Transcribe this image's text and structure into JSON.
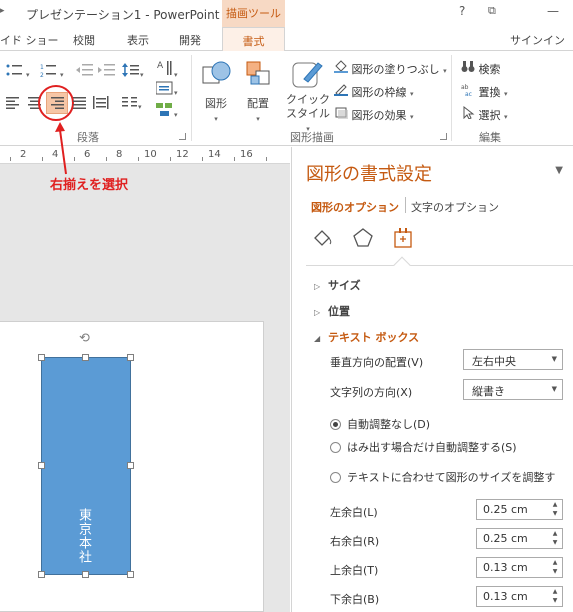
{
  "titlebar": {
    "title": "プレゼンテーション1 - PowerPoint",
    "context_tab_header": "描画ツール",
    "help": "?",
    "restore": "⧉",
    "minimize": "—"
  },
  "tabs": {
    "items": [
      "イド ショー",
      "校閲",
      "表示",
      "開発",
      "書式"
    ],
    "active": "書式",
    "signin": "サインイン"
  },
  "ribbon": {
    "paragraph_group": "段落",
    "drawing_group": "図形描画",
    "editing_group": "編集",
    "shape_button": "図形",
    "arrange_button": "配置",
    "quick_style_button_1": "クイック",
    "quick_style_button_2": "スタイル",
    "shape_fill": "図形の塗りつぶし",
    "shape_outline": "図形の枠線",
    "shape_effects": "図形の効果",
    "find": "検索",
    "replace": "置換",
    "select": "選択"
  },
  "annotation": {
    "text": "右揃えを選択",
    "color": "#e02020"
  },
  "ruler": {
    "ticks": [
      "2",
      "4",
      "6",
      "8",
      "10",
      "12",
      "14",
      "16"
    ]
  },
  "slide": {
    "shape_text": "東京本社",
    "shape_color": "#5b9bd5"
  },
  "pane": {
    "title": "図形の書式設定",
    "tab_shape_options": "図形のオプション",
    "tab_text_options": "文字のオプション",
    "sections": {
      "size": "サイズ",
      "position": "位置",
      "textbox": "テキスト ボックス"
    },
    "vertical_alignment_label": "垂直方向の配置(V)",
    "vertical_alignment_value": "左右中央",
    "text_direction_label": "文字列の方向(X)",
    "text_direction_value": "縦書き",
    "autofit_none": "自動調整なし(D)",
    "autofit_shrink": "はみ出す場合だけ自動調整する(S)",
    "autofit_resize": "テキストに合わせて図形のサイズを調整す",
    "left_margin_label": "左余白(L)",
    "left_margin_value": "0.25 cm",
    "right_margin_label": "右余白(R)",
    "right_margin_value": "0.25 cm",
    "top_margin_label": "上余白(T)",
    "top_margin_value": "0.13 cm",
    "bottom_margin_label": "下余白(B)",
    "bottom_margin_value": "0.13 cm",
    "accent_color": "#c55a11"
  }
}
